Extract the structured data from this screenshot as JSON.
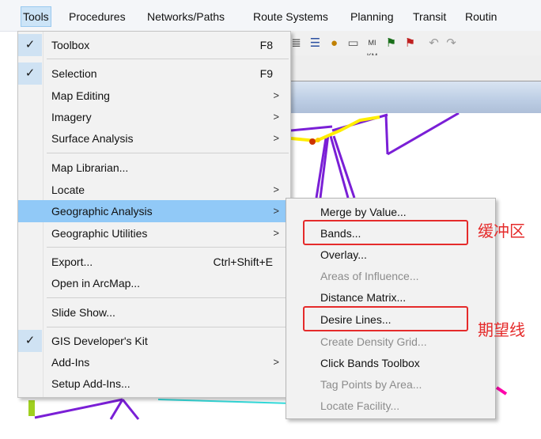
{
  "menubar": {
    "items": [
      "Tools",
      "Procedures",
      "Networks/Paths",
      "Route Systems",
      "Planning",
      "Transit",
      "Routin"
    ]
  },
  "tools_menu": {
    "items": [
      {
        "label": "Toolbox",
        "shortcut": "F8",
        "checked": true
      },
      {
        "label": "Selection",
        "shortcut": "F9",
        "checked": true
      },
      {
        "label": "Map Editing",
        "submenu": true
      },
      {
        "label": "Imagery",
        "submenu": true
      },
      {
        "label": "Surface Analysis",
        "submenu": true
      },
      {
        "label": "Map Librarian..."
      },
      {
        "label": "Locate",
        "submenu": true
      },
      {
        "label": "Geographic Analysis",
        "submenu": true,
        "highlighted": true
      },
      {
        "label": "Geographic Utilities",
        "submenu": true
      },
      {
        "label": "Export...",
        "shortcut": "Ctrl+Shift+E"
      },
      {
        "label": "Open in ArcMap..."
      },
      {
        "label": "Slide Show..."
      },
      {
        "label": "GIS Developer's Kit",
        "checked": true
      },
      {
        "label": "Add-Ins",
        "submenu": true
      },
      {
        "label": "Setup Add-Ins..."
      }
    ]
  },
  "geographic_analysis_submenu": {
    "items": [
      {
        "label": "Merge by Value...",
        "enabled": true
      },
      {
        "label": "Bands...",
        "enabled": true
      },
      {
        "label": "Overlay...",
        "enabled": true
      },
      {
        "label": "Areas of Influence...",
        "enabled": false
      },
      {
        "label": "Distance Matrix...",
        "enabled": true
      },
      {
        "label": "Desire Lines...",
        "enabled": true
      },
      {
        "label": "Create Density Grid...",
        "enabled": false
      },
      {
        "label": "Click Bands Toolbox",
        "enabled": true
      },
      {
        "label": "Tag Points by Area...",
        "enabled": false
      },
      {
        "label": "Locate Facility...",
        "enabled": false
      }
    ]
  },
  "annotations": {
    "bands": "缓冲区",
    "desire_lines": "期望线"
  },
  "colors": {
    "highlight": "#91c9f7",
    "annotation_red": "#e52b2b",
    "map_purple": "#7a1fd6",
    "map_yellow": "#ffee00",
    "map_cyan": "#33dddd",
    "map_magenta": "#ff00aa"
  },
  "icons": [
    "checkmark-icon",
    "submenu-arrow-icon"
  ]
}
